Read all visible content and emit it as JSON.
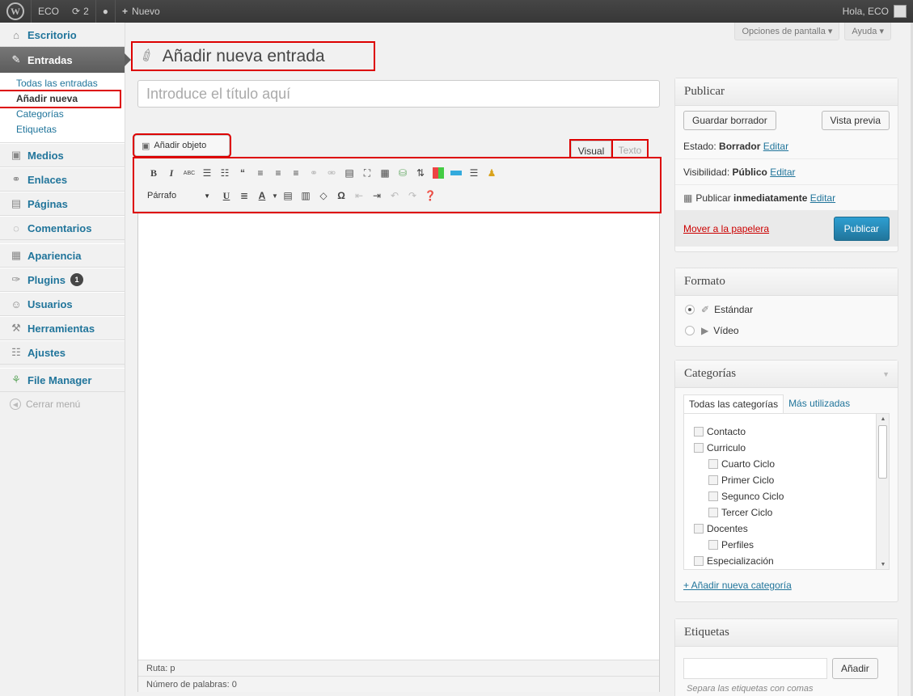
{
  "adminbar": {
    "site_name": "ECO",
    "updates_count": "2",
    "new_label": "Nuevo",
    "greeting": "Hola, ECO"
  },
  "sidebar": {
    "items": [
      {
        "label": "Escritorio",
        "icon": "home-icon",
        "glyph": "⌂"
      },
      {
        "label": "Entradas",
        "icon": "pin-icon",
        "glyph": "✎"
      },
      {
        "label": "Medios",
        "icon": "media-icon",
        "glyph": "▣"
      },
      {
        "label": "Enlaces",
        "icon": "link-icon",
        "glyph": "⚭"
      },
      {
        "label": "Páginas",
        "icon": "pages-icon",
        "glyph": "▤"
      },
      {
        "label": "Comentarios",
        "icon": "comment-icon",
        "glyph": "◌"
      },
      {
        "label": "Apariencia",
        "icon": "appearance-icon",
        "glyph": "▦"
      },
      {
        "label": "Plugins",
        "icon": "plugin-icon",
        "glyph": "✑",
        "badge": "1"
      },
      {
        "label": "Usuarios",
        "icon": "users-icon",
        "glyph": "☺"
      },
      {
        "label": "Herramientas",
        "icon": "tools-icon",
        "glyph": "⚒"
      },
      {
        "label": "Ajustes",
        "icon": "settings-icon",
        "glyph": "☷"
      },
      {
        "label": "File Manager",
        "icon": "file-manager-icon",
        "glyph": "⚘"
      }
    ],
    "submenu": [
      "Todas las entradas",
      "Añadir nueva",
      "Categorías",
      "Etiquetas"
    ],
    "collapse_label": "Cerrar menú"
  },
  "screen_options": {
    "options": "Opciones de pantalla",
    "help": "Ayuda"
  },
  "page_title": "Añadir nueva entrada",
  "title_placeholder": "Introduce el título aquí",
  "editor": {
    "add_media": "Añadir objeto",
    "tab_visual": "Visual",
    "tab_text": "Texto",
    "format_select": "Párrafo",
    "path_label": "Ruta: p",
    "word_count": "Número de palabras: 0"
  },
  "publish": {
    "title": "Publicar",
    "save_draft": "Guardar borrador",
    "preview": "Vista previa",
    "status_label": "Estado:",
    "status_value": "Borrador",
    "visibility_label": "Visibilidad:",
    "visibility_value": "Público",
    "schedule_label": "Publicar",
    "schedule_value": "inmediatamente",
    "edit": "Editar",
    "trash": "Mover a la papelera",
    "publish_button": "Publicar"
  },
  "format": {
    "title": "Formato",
    "options": [
      {
        "label": "Estándar",
        "selected": true
      },
      {
        "label": "Vídeo",
        "selected": false
      }
    ]
  },
  "categories": {
    "title": "Categorías",
    "tab_all": "Todas las categorías",
    "tab_popular": "Más utilizadas",
    "items": [
      {
        "label": "Contacto",
        "level": 0
      },
      {
        "label": "Curriculo",
        "level": 0
      },
      {
        "label": "Cuarto Ciclo",
        "level": 1
      },
      {
        "label": "Primer Ciclo",
        "level": 1
      },
      {
        "label": "Segunco Ciclo",
        "level": 1
      },
      {
        "label": "Tercer Ciclo",
        "level": 1
      },
      {
        "label": "Docentes",
        "level": 0
      },
      {
        "label": "Perfiles",
        "level": 1
      },
      {
        "label": "Especialización",
        "level": 0
      }
    ],
    "add_new": "+ Añadir nueva categoría"
  },
  "tags": {
    "title": "Etiquetas",
    "add_button": "Añadir",
    "hint": "Separa las etiquetas con comas"
  },
  "colors": {
    "link": "#21759b",
    "primary": "#21759b",
    "highlight": "#dd0000"
  }
}
